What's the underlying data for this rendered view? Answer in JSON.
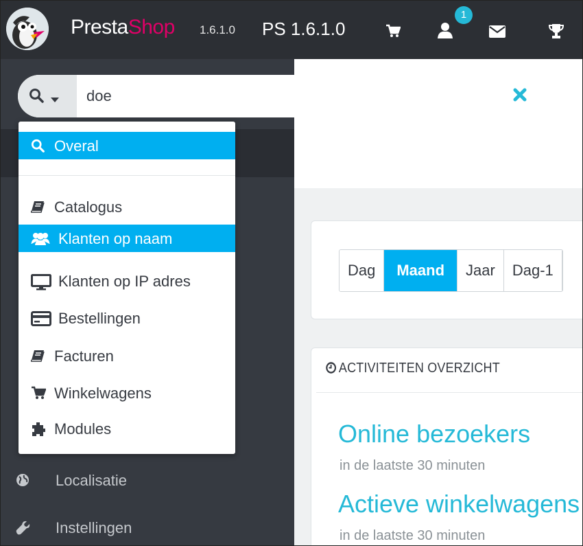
{
  "topbar": {
    "brand_presta": "Presta",
    "brand_shop": "Shop",
    "version": "1.6.1.0",
    "shop_label": "PS 1.6.1.0",
    "notification_count": "1",
    "icons": [
      "cart-icon",
      "user-icon",
      "mail-icon",
      "trophy-icon"
    ]
  },
  "search": {
    "value": "doe"
  },
  "search_dropdown": {
    "items": [
      {
        "label": "Overal",
        "icon": "search-icon"
      },
      {
        "label": "Catalogus",
        "icon": "book-icon"
      },
      {
        "label": "Klanten op naam",
        "icon": "users-icon"
      },
      {
        "label": "Klanten op IP adres",
        "icon": "desktop-icon"
      },
      {
        "label": "Bestellingen",
        "icon": "credit-card-icon"
      },
      {
        "label": "Facturen",
        "icon": "book-icon"
      },
      {
        "label": "Winkelwagens",
        "icon": "cart-icon"
      },
      {
        "label": "Modules",
        "icon": "puzzle-icon"
      }
    ],
    "selected": "Overal",
    "hovered": "Klanten op naam"
  },
  "sidebar": {
    "items": [
      {
        "label": "Localisatie",
        "icon": "globe-icon"
      },
      {
        "label": "Instellingen",
        "icon": "wrench-icon"
      }
    ]
  },
  "dashboard": {
    "period_buttons": [
      "Dag",
      "Maand",
      "Jaar",
      "Dag-1"
    ],
    "active_period": "Maand",
    "activity": {
      "title": "ACTIVITEITEN OVERZICHT",
      "online_title": "Online bezoekers",
      "online_sub": "in de laatste 30 minuten",
      "carts_title": "Actieve winkelwagens",
      "carts_sub": "in de laatste 30 minuten"
    }
  },
  "colors": {
    "topbar": "#2c2f34",
    "sidebar": "#363a41",
    "accent": "#00aff0",
    "link": "#25b9d7",
    "brand_shop": "#df0067"
  }
}
